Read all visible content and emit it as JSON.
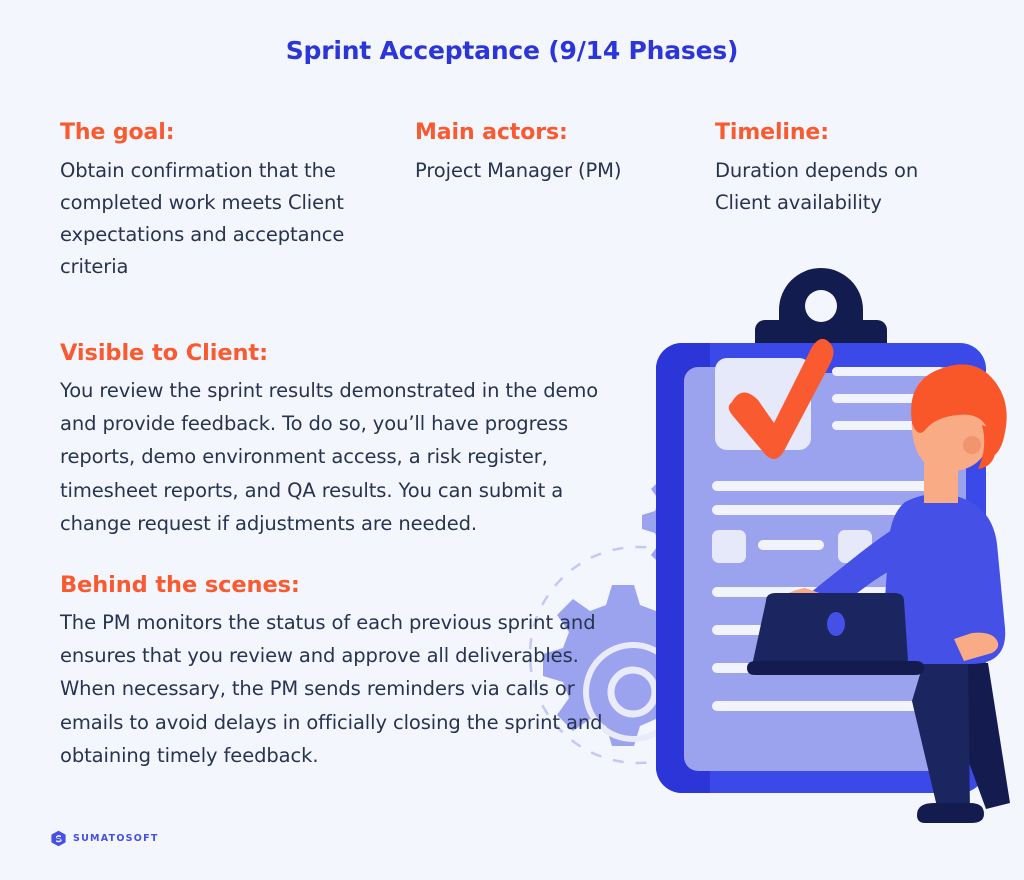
{
  "page": {
    "title": "Sprint Acceptance (9/14 Phases)",
    "background_color": "#f4f6fd",
    "accent_orange": "#f95a30",
    "accent_blue": "#2c35d8",
    "body_text_color": "#27344f"
  },
  "info_columns": {
    "goal": {
      "heading": "The goal:",
      "text": "Obtain confirmation that the completed work meets Client expectations and acceptance criteria"
    },
    "actors": {
      "heading": "Main actors:",
      "text": "Project Manager (PM)"
    },
    "timeline": {
      "heading": "Timeline:",
      "text": "Duration depends on Client availability"
    }
  },
  "sections": {
    "visible_to_client": {
      "heading": "Visible to Client:",
      "text": "You review the sprint results demonstrated in the demo and provide feedback. To do so, you’ll have progress reports, demo environment access, a risk register, timesheet reports, and QA results. You can submit a change request if adjustments are needed."
    },
    "behind_the_scenes": {
      "heading": "Behind the scenes:",
      "text": "The PM monitors the status of each previous sprint and ensures that you review and approve all deliverables. When necessary, the PM sends reminders via calls or emails to avoid delays in officially closing the sprint and obtaining timely feedback."
    }
  },
  "illustration": {
    "name": "clipboard-checklist-with-person",
    "clip_color": "#131c4e",
    "board_border_color": "#3b49e8",
    "board_page_color": "#9ca3ee",
    "line_color": "#eef0fb",
    "check_color": "#f95a30",
    "gear_color": "#9ba3ef",
    "hair_color": "#f9572a",
    "skin_color": "#f8ab84",
    "sweater_color": "#4450e6",
    "trousers_color": "#141c4f"
  },
  "footer": {
    "logo_text": "SUMATOSOFT",
    "logo_color": "#4450e6"
  }
}
